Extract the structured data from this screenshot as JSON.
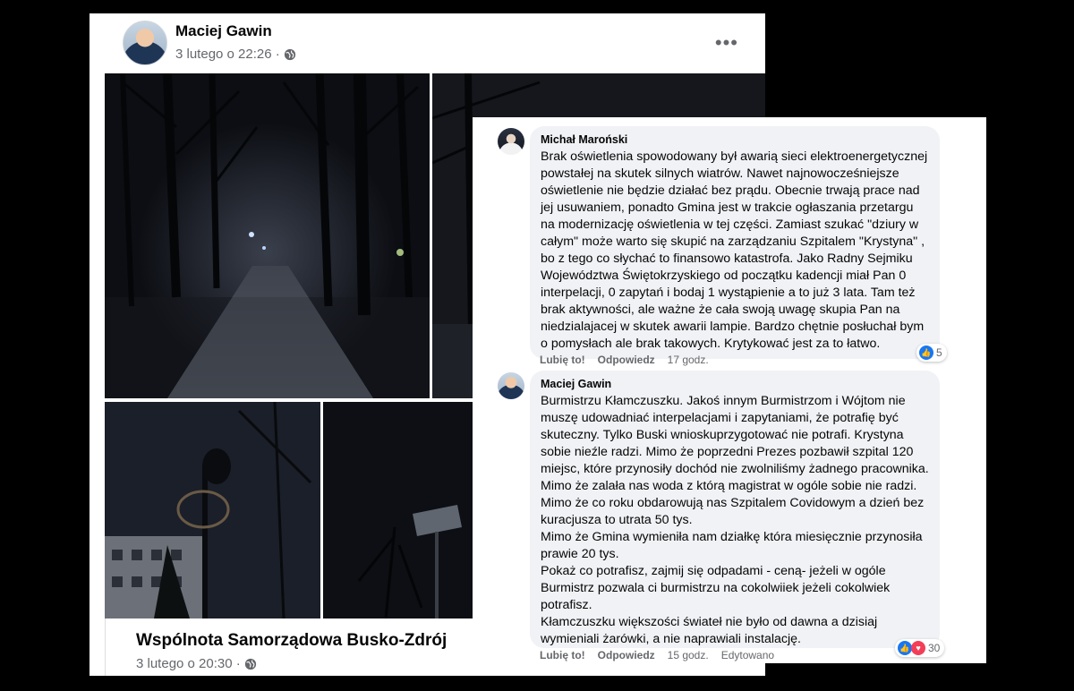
{
  "post": {
    "author": "Maciej Gawin",
    "timestamp": "3 lutego o 22:26 ·",
    "privacy_icon": "globe-icon",
    "menu_icon": "more-options-icon",
    "shared": {
      "title": "Wspólnota Samorządowa Busko-Zdrój",
      "timestamp": "3 lutego o 20:30 ·"
    }
  },
  "comments": [
    {
      "author": "Michał Maroński",
      "text": "Brak oświetlenia spowodowany był awarią sieci elektroenergetycznej powstałej na skutek silnych wiatrów. Nawet najnowocześniejsze oświetlenie nie będzie działać bez prądu. Obecnie trwają prace nad jej usuwaniem, ponadto Gmina jest w trakcie ogłaszania przetargu na modernizację oświetlenia w tej części. Zamiast szukać \"dziury w całym\" może warto się skupić na zarządzaniu Szpitalem \"Krystyna\" , bo z tego co słychać to finansowo katastrofa. Jako Radny Sejmiku Województwa Świętokrzyskiego od początku kadencji miał Pan 0 interpelacji, 0 zapytań i bodaj 1 wystąpienie a to już 3 lata. Tam też brak aktywności, ale ważne że cała swoją uwagę skupia Pan na niedzialajacej w skutek awarii lampie. Bardzo chętnie posłuchał bym o pomysłach ale brak takowych. Krytykować jest za to łatwo.",
      "like": "Lubię to!",
      "reply": "Odpowiedz",
      "time": "17 godz.",
      "reactions": "5"
    },
    {
      "author": "Maciej Gawin",
      "paragraphs": [
        "Burmistrzu Kłamczuszku. Jakoś innym Burmistrzom i Wójtom nie muszę udowadniać interpelacjami i zapytaniami, że potrafię być skuteczny. Tylko Buski wnioskuprzygotować nie potrafi. Krystyna sobie nieźle radzi. Mimo że poprzedni Prezes pozbawił szpital 120 miejsc, które przynosiły dochód nie zwolniliśmy żadnego pracownika. Mimo że zalała nas woda z którą magistrat w ogóle sobie nie radzi. Mimo że co roku obdarowują nas Szpitalem Covidowym a dzień bez kuracjusza to utrata 50 tys.",
        "Mimo że Gmina wymieniła nam działkę która miesięcznie przynosiła prawie 20 tys.",
        "Pokaż co potrafisz, zajmij się odpadami - ceną- jeżeli w ogóle Burmistrz pozwala ci burmistrzu na cokolwiiek jeżeli cokolwiek potrafisz.",
        "Kłamczuszku większości świateł nie było od dawna a dzisiaj wymieniali żarówki, a nie naprawiali instalację."
      ],
      "like": "Lubię to!",
      "reply": "Odpowiedz",
      "time": "15 godz.",
      "edited": "Edytowano",
      "reactions": "30"
    }
  ]
}
